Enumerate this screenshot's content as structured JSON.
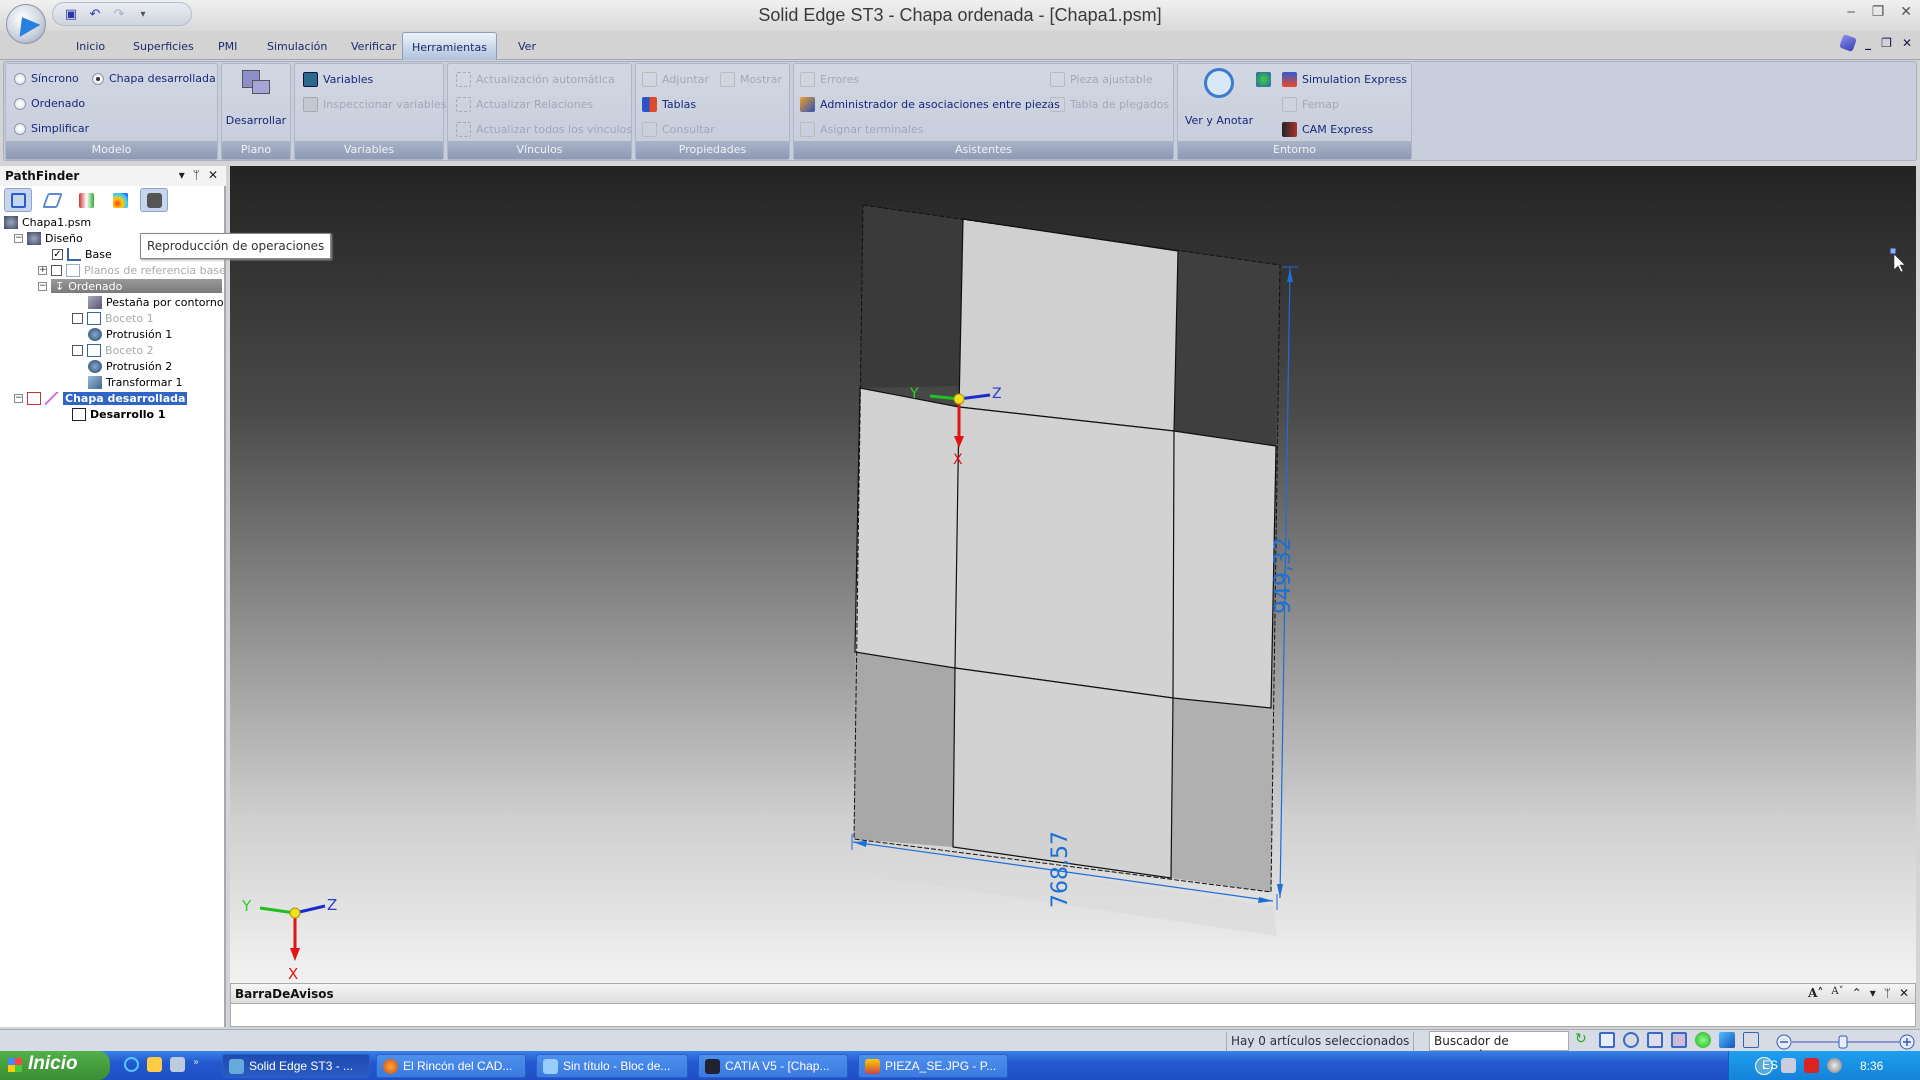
{
  "window": {
    "title": "Solid Edge ST3 - Chapa ordenada - [Chapa1.psm]",
    "controls": {
      "minimize": "‒",
      "restore": "❐",
      "close": "✕"
    },
    "doc_controls": {
      "help": "help-book-icon",
      "minimize": "_",
      "restore": "❐",
      "close": "✕"
    }
  },
  "quick_access": {
    "items": [
      {
        "name": "save-icon",
        "glyph": "💾"
      },
      {
        "name": "undo-icon",
        "glyph": "↶"
      },
      {
        "name": "redo-icon",
        "glyph": "↷"
      },
      {
        "name": "customize-icon",
        "glyph": "▾"
      }
    ]
  },
  "tabs": [
    {
      "label": "Inicio"
    },
    {
      "label": "Superficies"
    },
    {
      "label": "PMI"
    },
    {
      "label": "Simulación"
    },
    {
      "label": "Verificar"
    },
    {
      "label": "Herramientas",
      "active": true
    },
    {
      "label": "Ver"
    }
  ],
  "ribbon": {
    "modelo": {
      "label": "Modelo",
      "options": [
        {
          "label": "Síncrono",
          "selected": false
        },
        {
          "label": "Chapa desarrollada",
          "selected": true
        },
        {
          "label": "Ordenado",
          "selected": false
        },
        {
          "label": "Simplificar",
          "selected": false
        }
      ]
    },
    "plano": {
      "label": "Plano",
      "button": "Desarrollar"
    },
    "variables": {
      "label": "Variables",
      "items": [
        {
          "label": "Variables",
          "enabled": true
        },
        {
          "label": "Inspeccionar variables",
          "enabled": false
        }
      ]
    },
    "vinculos": {
      "label": "Vínculos",
      "items": [
        {
          "label": "Actualización automática",
          "enabled": false
        },
        {
          "label": "Actualizar Relaciones",
          "enabled": false
        },
        {
          "label": "Actualizar todos los vínculos",
          "enabled": false
        }
      ]
    },
    "propiedades": {
      "label": "Propiedades",
      "items": [
        {
          "label": "Adjuntar",
          "enabled": false
        },
        {
          "label": "Mostrar",
          "enabled": false
        },
        {
          "label": "Tablas",
          "enabled": true
        },
        {
          "label": "Consultar",
          "enabled": false
        }
      ]
    },
    "asistentes": {
      "label": "Asistentes",
      "items": [
        {
          "label": "Errores",
          "enabled": false
        },
        {
          "label": "Administrador de asociaciones entre piezas",
          "enabled": true
        },
        {
          "label": "Asignar terminales",
          "enabled": false
        },
        {
          "label": "Pieza ajustable",
          "enabled": false
        },
        {
          "label": "Tabla de plegados",
          "enabled": false
        }
      ]
    },
    "entorno": {
      "label": "Entorno",
      "button": "Ver y Anotar",
      "items": [
        {
          "label": "Simulation Express",
          "enabled": true
        },
        {
          "label": "Femap",
          "enabled": false
        },
        {
          "label": "CAM Express",
          "enabled": true
        }
      ]
    }
  },
  "pathfinder": {
    "title": "PathFinder",
    "tooltip": "Reproducción de operaciones",
    "tree": [
      {
        "label": "Chapa1.psm",
        "level": 0
      },
      {
        "label": "Diseño",
        "level": 1,
        "expanded": true
      },
      {
        "label": "Base",
        "level": 2,
        "checked": true
      },
      {
        "label": "Planos de referencia base",
        "level": 2,
        "checked": false,
        "dimmed": true,
        "collapsed": true
      },
      {
        "label": "Ordenado",
        "level": 2,
        "expanded": true,
        "highlight": "gray"
      },
      {
        "label": "Pestaña por contorno",
        "level": 3
      },
      {
        "label": "Boceto 1",
        "level": 3,
        "checked": false,
        "dimmed": true
      },
      {
        "label": "Protrusión 1",
        "level": 3
      },
      {
        "label": "Boceto 2",
        "level": 3,
        "checked": false,
        "dimmed": true
      },
      {
        "label": "Protrusión 2",
        "level": 3
      },
      {
        "label": "Transformar 1",
        "level": 3
      },
      {
        "label": "Chapa desarrollada",
        "level": 1,
        "expanded": true,
        "selected": true
      },
      {
        "label": "Desarrollo 1",
        "level": 2,
        "bold": true
      }
    ]
  },
  "viewport": {
    "dimensions": {
      "width": "768,57",
      "height": "949,32"
    },
    "axes": {
      "x": "X",
      "y": "Y",
      "z": "Z"
    }
  },
  "notification_bar": {
    "title": "BarraDeAvisos"
  },
  "status_bar": {
    "selection": "Hay 0 artículos seleccionados",
    "command_finder": "Buscador de comando:"
  },
  "taskbar": {
    "start": "Inicio",
    "tasks": [
      {
        "label": "Solid Edge ST3 - ...",
        "active": true
      },
      {
        "label": "El Rincón del CAD..."
      },
      {
        "label": "Sin título - Bloc de..."
      },
      {
        "label": "CATIA V5 - [Chap..."
      },
      {
        "label": "PIEZA_SE.JPG - P..."
      }
    ],
    "language": "ES",
    "clock": "8:36"
  }
}
